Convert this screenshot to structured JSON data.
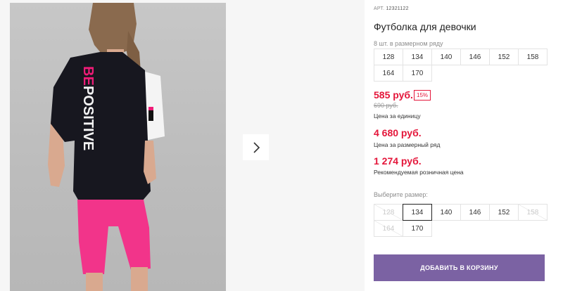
{
  "gallery": {
    "print_text": {
      "first": "BE",
      "second": "POSITIVE"
    },
    "next_icon": "chevron-right-icon",
    "colors": {
      "shirt": "#17171f",
      "sleeve": "#f4f4f4",
      "shorts": "#f2348a",
      "print_pink": "#ee1c77"
    }
  },
  "product": {
    "article_label": "АРТ.",
    "article_number": "12321122",
    "title": "Футболка для девочки"
  },
  "pack": {
    "label": "8 шт. в размерном ряду",
    "sizes": [
      "128",
      "134",
      "140",
      "146",
      "152",
      "158",
      "164",
      "170"
    ]
  },
  "pricing": {
    "unit_price": "585 руб.",
    "discount": "15%",
    "old_price": "690 руб.",
    "unit_note": "Цена за единицу",
    "pack_price": "4 680 руб.",
    "pack_note": "Цена за размерный ряд",
    "retail_price": "1 274 руб.",
    "retail_note": "Рекомендуемая розничная цена"
  },
  "size_select": {
    "label": "Выберите размер:",
    "sizes": [
      {
        "label": "128",
        "available": false
      },
      {
        "label": "134",
        "available": true,
        "selected": true
      },
      {
        "label": "140",
        "available": true
      },
      {
        "label": "146",
        "available": true
      },
      {
        "label": "152",
        "available": true
      },
      {
        "label": "158",
        "available": false
      },
      {
        "label": "164",
        "available": false
      },
      {
        "label": "170",
        "available": true
      }
    ]
  },
  "actions": {
    "add_to_cart": "ДОБАВИТЬ В КОРЗИНУ"
  },
  "colors": {
    "accent_red": "#e4163a",
    "button_purple": "#7b62a3"
  }
}
